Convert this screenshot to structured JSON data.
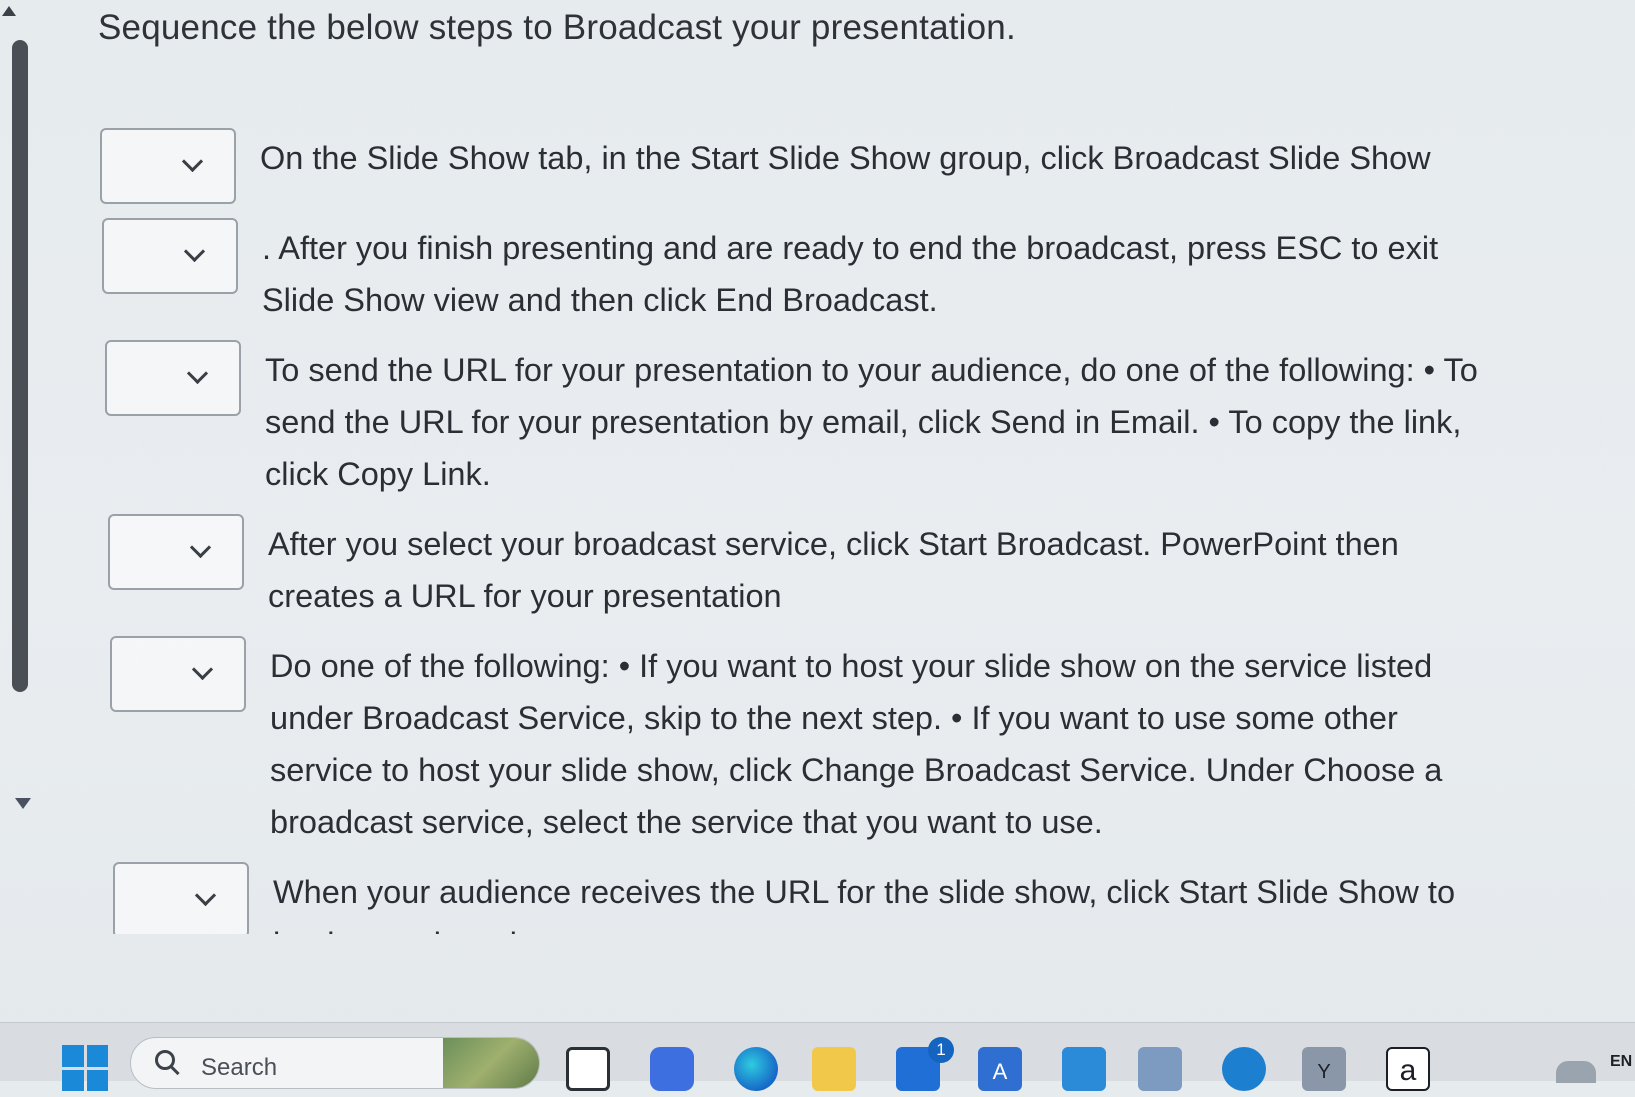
{
  "question": {
    "title": "Sequence the below steps to Broadcast your presentation."
  },
  "steps": [
    {
      "text": "On the Slide Show tab, in the Start Slide Show group, click Broadcast Slide Show"
    },
    {
      "text": ". After you finish presenting and are ready to end the broadcast, press ESC to exit Slide Show view and then click End Broadcast."
    },
    {
      "text": "To send the URL for your presentation to your audience, do one of the following: • To send the URL for your presentation by email, click Send in Email. • To copy the link, click Copy Link."
    },
    {
      "text": "After you select your broadcast service, click Start Broadcast. PowerPoint then creates a URL for your presentation"
    },
    {
      "text": "Do one of the following: • If you want to host your slide show on the service listed under Broadcast Service, skip to the next step. • If you want to use some other service to host your slide show, click Change Broadcast Service. Under Choose a broadcast service, select the service that you want to use."
    },
    {
      "text": "When your audience receives the URL for the slide show, click Start Slide Show to begin your broadcast"
    }
  ],
  "taskbar": {
    "search_label": "Search",
    "mail_badge": "1",
    "a_label": "A",
    "y_label": "Y",
    "amazon_label": "a",
    "language": "EN"
  }
}
